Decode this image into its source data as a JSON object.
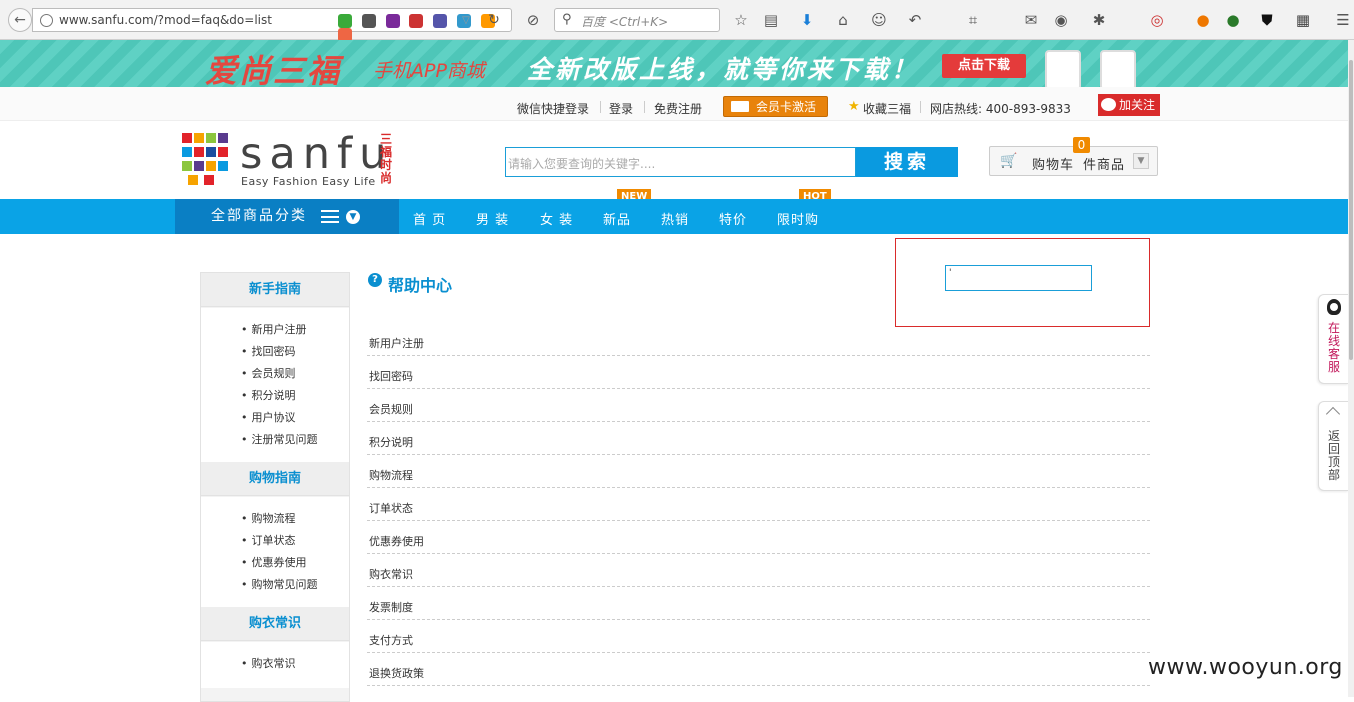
{
  "browser": {
    "url": "www.sanfu.com/?mod=faq&do=list",
    "search_placeholder": "百度 <Ctrl+K>"
  },
  "banner": {
    "brand": "爱尚三福",
    "app_mall": "手机APP商城",
    "slogan": "全新改版上线，就等你来下载！",
    "download_label": "点击下载"
  },
  "top_links": {
    "wechat_login": "微信快捷登录",
    "login": "登录",
    "register": "免费注册",
    "vip_activate": "会员卡激活",
    "favorite": "收藏三福",
    "hotline": "网店热线: 400-893-9833",
    "weibo_follow": "加关注"
  },
  "header": {
    "logo_word": "sanfu",
    "logo_tagline": "Easy Fashion  Easy Life",
    "logo_cn": "三福时尚",
    "search_placeholder": "请输入您要查询的关键字....",
    "search_button": "搜索",
    "cart_label": "购物车",
    "cart_suffix": "件商品",
    "cart_count": "0"
  },
  "nav": {
    "all_categories": "全部商品分类",
    "items": [
      "首 页",
      "男 装",
      "女 装",
      "新品",
      "热销",
      "特价",
      "限时购"
    ],
    "tag_new": "NEW",
    "tag_hot": "HOT"
  },
  "sidebar": {
    "sections": [
      {
        "title": "新手指南",
        "links": [
          "新用户注册",
          "找回密码",
          "会员规则",
          "积分说明",
          "用户协议",
          "注册常见问题"
        ]
      },
      {
        "title": "购物指南",
        "links": [
          "购物流程",
          "订单状态",
          "优惠券使用",
          "购物常见问题"
        ]
      },
      {
        "title": "购衣常识",
        "links": [
          "购衣常识"
        ]
      }
    ]
  },
  "main": {
    "title": "帮助中心",
    "injected_input_value": "'",
    "faq_items": [
      "新用户注册",
      "找回密码",
      "会员规则",
      "积分说明",
      "购物流程",
      "订单状态",
      "优惠券使用",
      "购衣常识",
      "发票制度",
      "支付方式",
      "退换货政策"
    ]
  },
  "floats": {
    "online_service": "在线客服",
    "back_to_top": "返回顶部"
  },
  "watermark": "www.wooyun.org",
  "colors": {
    "brand_blue": "#0aa3e6",
    "accent_orange": "#f08a00",
    "alert_red": "#d92b2b"
  }
}
